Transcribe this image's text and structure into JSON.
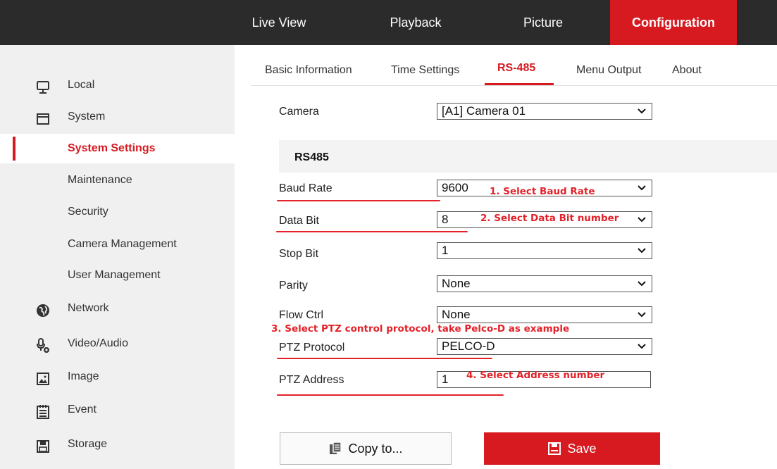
{
  "topnav": {
    "items": [
      {
        "label": "Live View"
      },
      {
        "label": "Playback"
      },
      {
        "label": "Picture"
      },
      {
        "label": "Configuration"
      }
    ],
    "active": "Configuration"
  },
  "sidebar": {
    "items": [
      {
        "label": "Local",
        "icon": "monitor-icon"
      },
      {
        "label": "System",
        "icon": "window-icon"
      },
      {
        "label": "System Settings",
        "sub": true,
        "active": true
      },
      {
        "label": "Maintenance",
        "sub": true
      },
      {
        "label": "Security",
        "sub": true
      },
      {
        "label": "Camera Management",
        "sub": true
      },
      {
        "label": "User Management",
        "sub": true
      },
      {
        "label": "Network",
        "icon": "globe-icon"
      },
      {
        "label": "Video/Audio",
        "icon": "microphone-camera-icon"
      },
      {
        "label": "Image",
        "icon": "image-icon"
      },
      {
        "label": "Event",
        "icon": "calendar-list-icon"
      },
      {
        "label": "Storage",
        "icon": "save-disk-icon"
      }
    ]
  },
  "tabs": {
    "items": [
      {
        "label": "Basic Information"
      },
      {
        "label": "Time Settings"
      },
      {
        "label": "RS-485"
      },
      {
        "label": "Menu Output"
      },
      {
        "label": "About"
      }
    ],
    "active": "RS-485"
  },
  "form": {
    "camera_label": "Camera",
    "camera_value": "[A1] Camera 01",
    "section_title": "RS485",
    "baud_label": "Baud Rate",
    "baud_value": "9600",
    "databit_label": "Data Bit",
    "databit_value": "8",
    "stopbit_label": "Stop Bit",
    "stopbit_value": "1",
    "parity_label": "Parity",
    "parity_value": "None",
    "flow_label": "Flow Ctrl",
    "flow_value": "None",
    "ptz_protocol_label": "PTZ Protocol",
    "ptz_protocol_value": "PELCO-D",
    "ptz_address_label": "PTZ Address",
    "ptz_address_value": "1"
  },
  "annotations": {
    "a1": "1. Select Baud Rate",
    "a2": "2. Select Data Bit number",
    "a3": "3. Select PTZ control protocol, take Pelco-D as example",
    "a4": "4. Select Address number",
    "color": "#e3222a"
  },
  "buttons": {
    "copy_label": "Copy to...",
    "save_label": "Save"
  },
  "colors": {
    "accent": "#d71920",
    "topbar": "#2b2b2b",
    "sidebar": "#f0f0f0"
  }
}
